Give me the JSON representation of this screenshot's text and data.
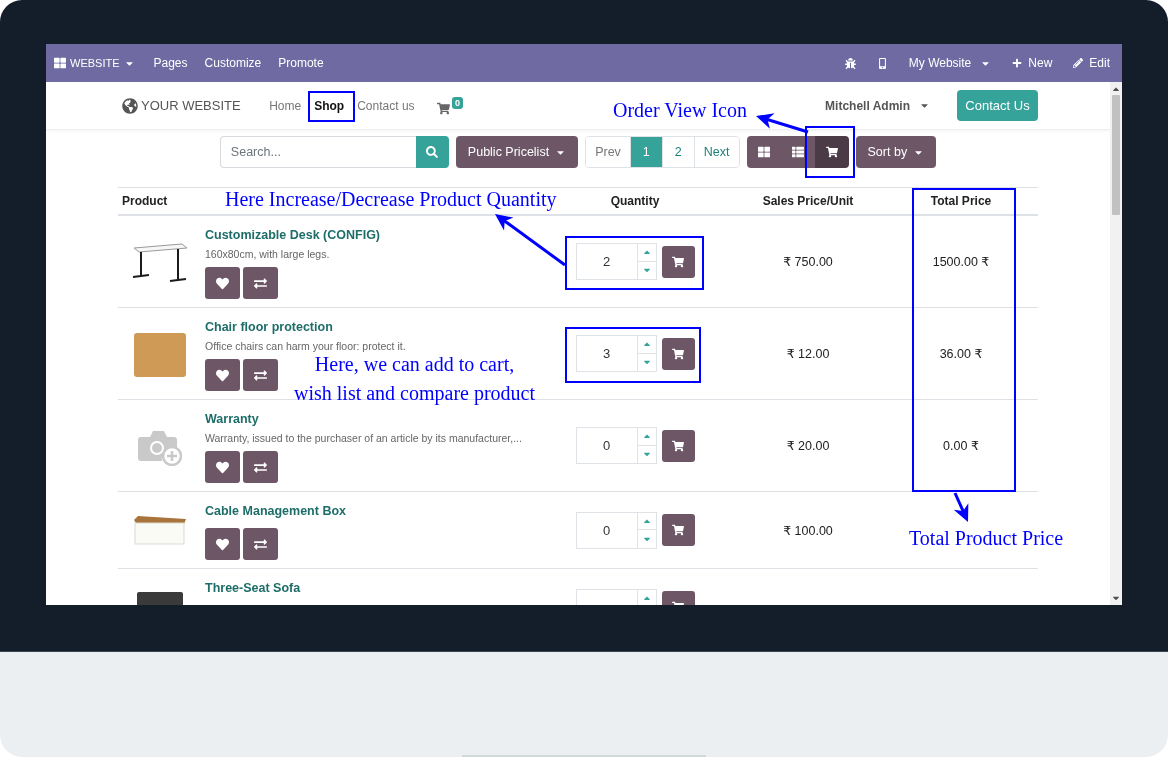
{
  "admin_bar": {
    "app_menu": "WEBSITE",
    "menu": [
      "Pages",
      "Customize",
      "Promote"
    ],
    "website_menu": "My Website",
    "new_button": "New",
    "edit_button": "Edit"
  },
  "header": {
    "logo": "YOUR WEBSITE",
    "nav": [
      {
        "label": "Home",
        "selected": false
      },
      {
        "label": "Shop",
        "selected": true
      },
      {
        "label": "Contact us",
        "selected": false
      }
    ],
    "cart_count": "0",
    "user_menu": "Mitchell Admin",
    "contact_button": "Contact Us"
  },
  "toolbar": {
    "search": {
      "placeholder": "Search..."
    },
    "pricelist": "Public Pricelist",
    "pagination": [
      {
        "label": "Prev",
        "selected": false,
        "disabled": true
      },
      {
        "label": "1",
        "selected": true,
        "disabled": false
      },
      {
        "label": "2",
        "selected": false,
        "disabled": false
      },
      {
        "label": "Next",
        "selected": false,
        "disabled": false
      }
    ],
    "views": [
      {
        "kind": "grid",
        "selected": false
      },
      {
        "kind": "list",
        "selected": false
      },
      {
        "kind": "order",
        "selected": true
      }
    ],
    "sort": "Sort by"
  },
  "table": {
    "columns": [
      "Product",
      "Quantity",
      "Sales Price/Unit",
      "Total Price"
    ],
    "rows": [
      {
        "kind": "desk",
        "name": "Customizable Desk (CONFIG)",
        "description": "160x80cm, with large legs.",
        "quantity": "2",
        "unit_price": "₹ 750.00",
        "total": "1500.00 ₹"
      },
      {
        "kind": "photo",
        "name": "Chair floor protection",
        "description": "Office chairs can harm your floor: protect it.",
        "quantity": "3",
        "unit_price": "₹ 12.00",
        "total": "36.00 ₹"
      },
      {
        "kind": "placeholder",
        "name": "Warranty",
        "description": "Warranty, issued to the purchaser of an article by its manufacturer,...",
        "quantity": "0",
        "unit_price": "₹ 20.00",
        "total": "0.00 ₹"
      },
      {
        "kind": "box",
        "name": "Cable Management Box",
        "quantity": "0",
        "unit_price": "₹ 100.00"
      },
      {
        "kind": "sofa",
        "name": "Three-Seat Sofa"
      }
    ]
  },
  "annotations": [
    {
      "text": "Order View Icon"
    },
    {
      "text": "Here Increase/Decrease Product Quantity"
    },
    {
      "text": "Here, we can add to cart,\nwish list and compare product"
    },
    {
      "text": "Total Product Price"
    }
  ]
}
